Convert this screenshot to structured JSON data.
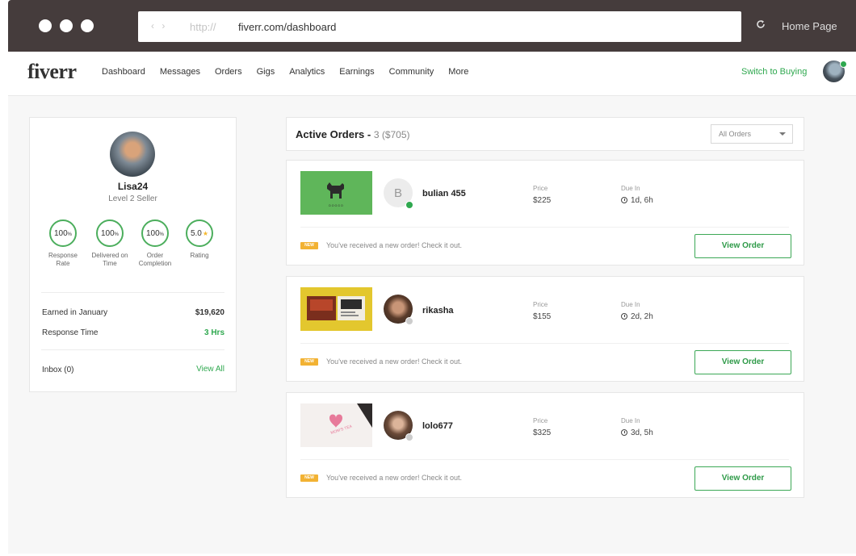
{
  "browser": {
    "nav_arrows": "‹ ›",
    "protocol": "http://",
    "url": "fiverr.com/dashboard",
    "home_label": "Home Page"
  },
  "nav": {
    "logo": "fiverr",
    "items": [
      "Dashboard",
      "Messages",
      "Orders",
      "Gigs",
      "Analytics",
      "Earnings",
      "Community",
      "More"
    ],
    "switch_label": "Switch to Buying"
  },
  "profile": {
    "username": "Lisa24",
    "level": "Level 2 Seller",
    "stats": [
      {
        "value": "100",
        "unit": "%",
        "label1": "Response",
        "label2": "Rate"
      },
      {
        "value": "100",
        "unit": "%",
        "label1": "Delivered on",
        "label2": "Time"
      },
      {
        "value": "100",
        "unit": "%",
        "label1": "Order",
        "label2": "Completion"
      },
      {
        "value": "5.0",
        "unit": "★",
        "label1": "Rating",
        "label2": ""
      }
    ],
    "earned_label": "Earned in January",
    "earned_value": "$19,620",
    "response_label": "Response Time",
    "response_value": "3 Hrs",
    "inbox_label": "Inbox (0)",
    "view_all": "View All"
  },
  "orders": {
    "title": "Active Orders -",
    "count": "3 ($705)",
    "filter": "All Orders",
    "price_label": "Price",
    "due_label": "Due In",
    "badge": "NEW",
    "message": "You've received a new order! Check it out.",
    "button": "View Order",
    "list": [
      {
        "user": "bulian 455",
        "initial": "B",
        "price": "$225",
        "due": "1d, 6h",
        "online_color": "#2fa84f",
        "thumb_caption": "DOGGO"
      },
      {
        "user": "rikasha",
        "initial": "",
        "price": "$155",
        "due": "2d, 2h",
        "online_color": "#cccccc",
        "thumb_caption": ""
      },
      {
        "user": "lolo677",
        "initial": "",
        "price": "$325",
        "due": "3d, 5h",
        "online_color": "#cccccc",
        "thumb_caption": "MOM'S TEA"
      }
    ]
  },
  "colors": {
    "chrome": "#453c3c",
    "accent_green": "#2fa84f",
    "badge_yellow": "#f2b233"
  }
}
